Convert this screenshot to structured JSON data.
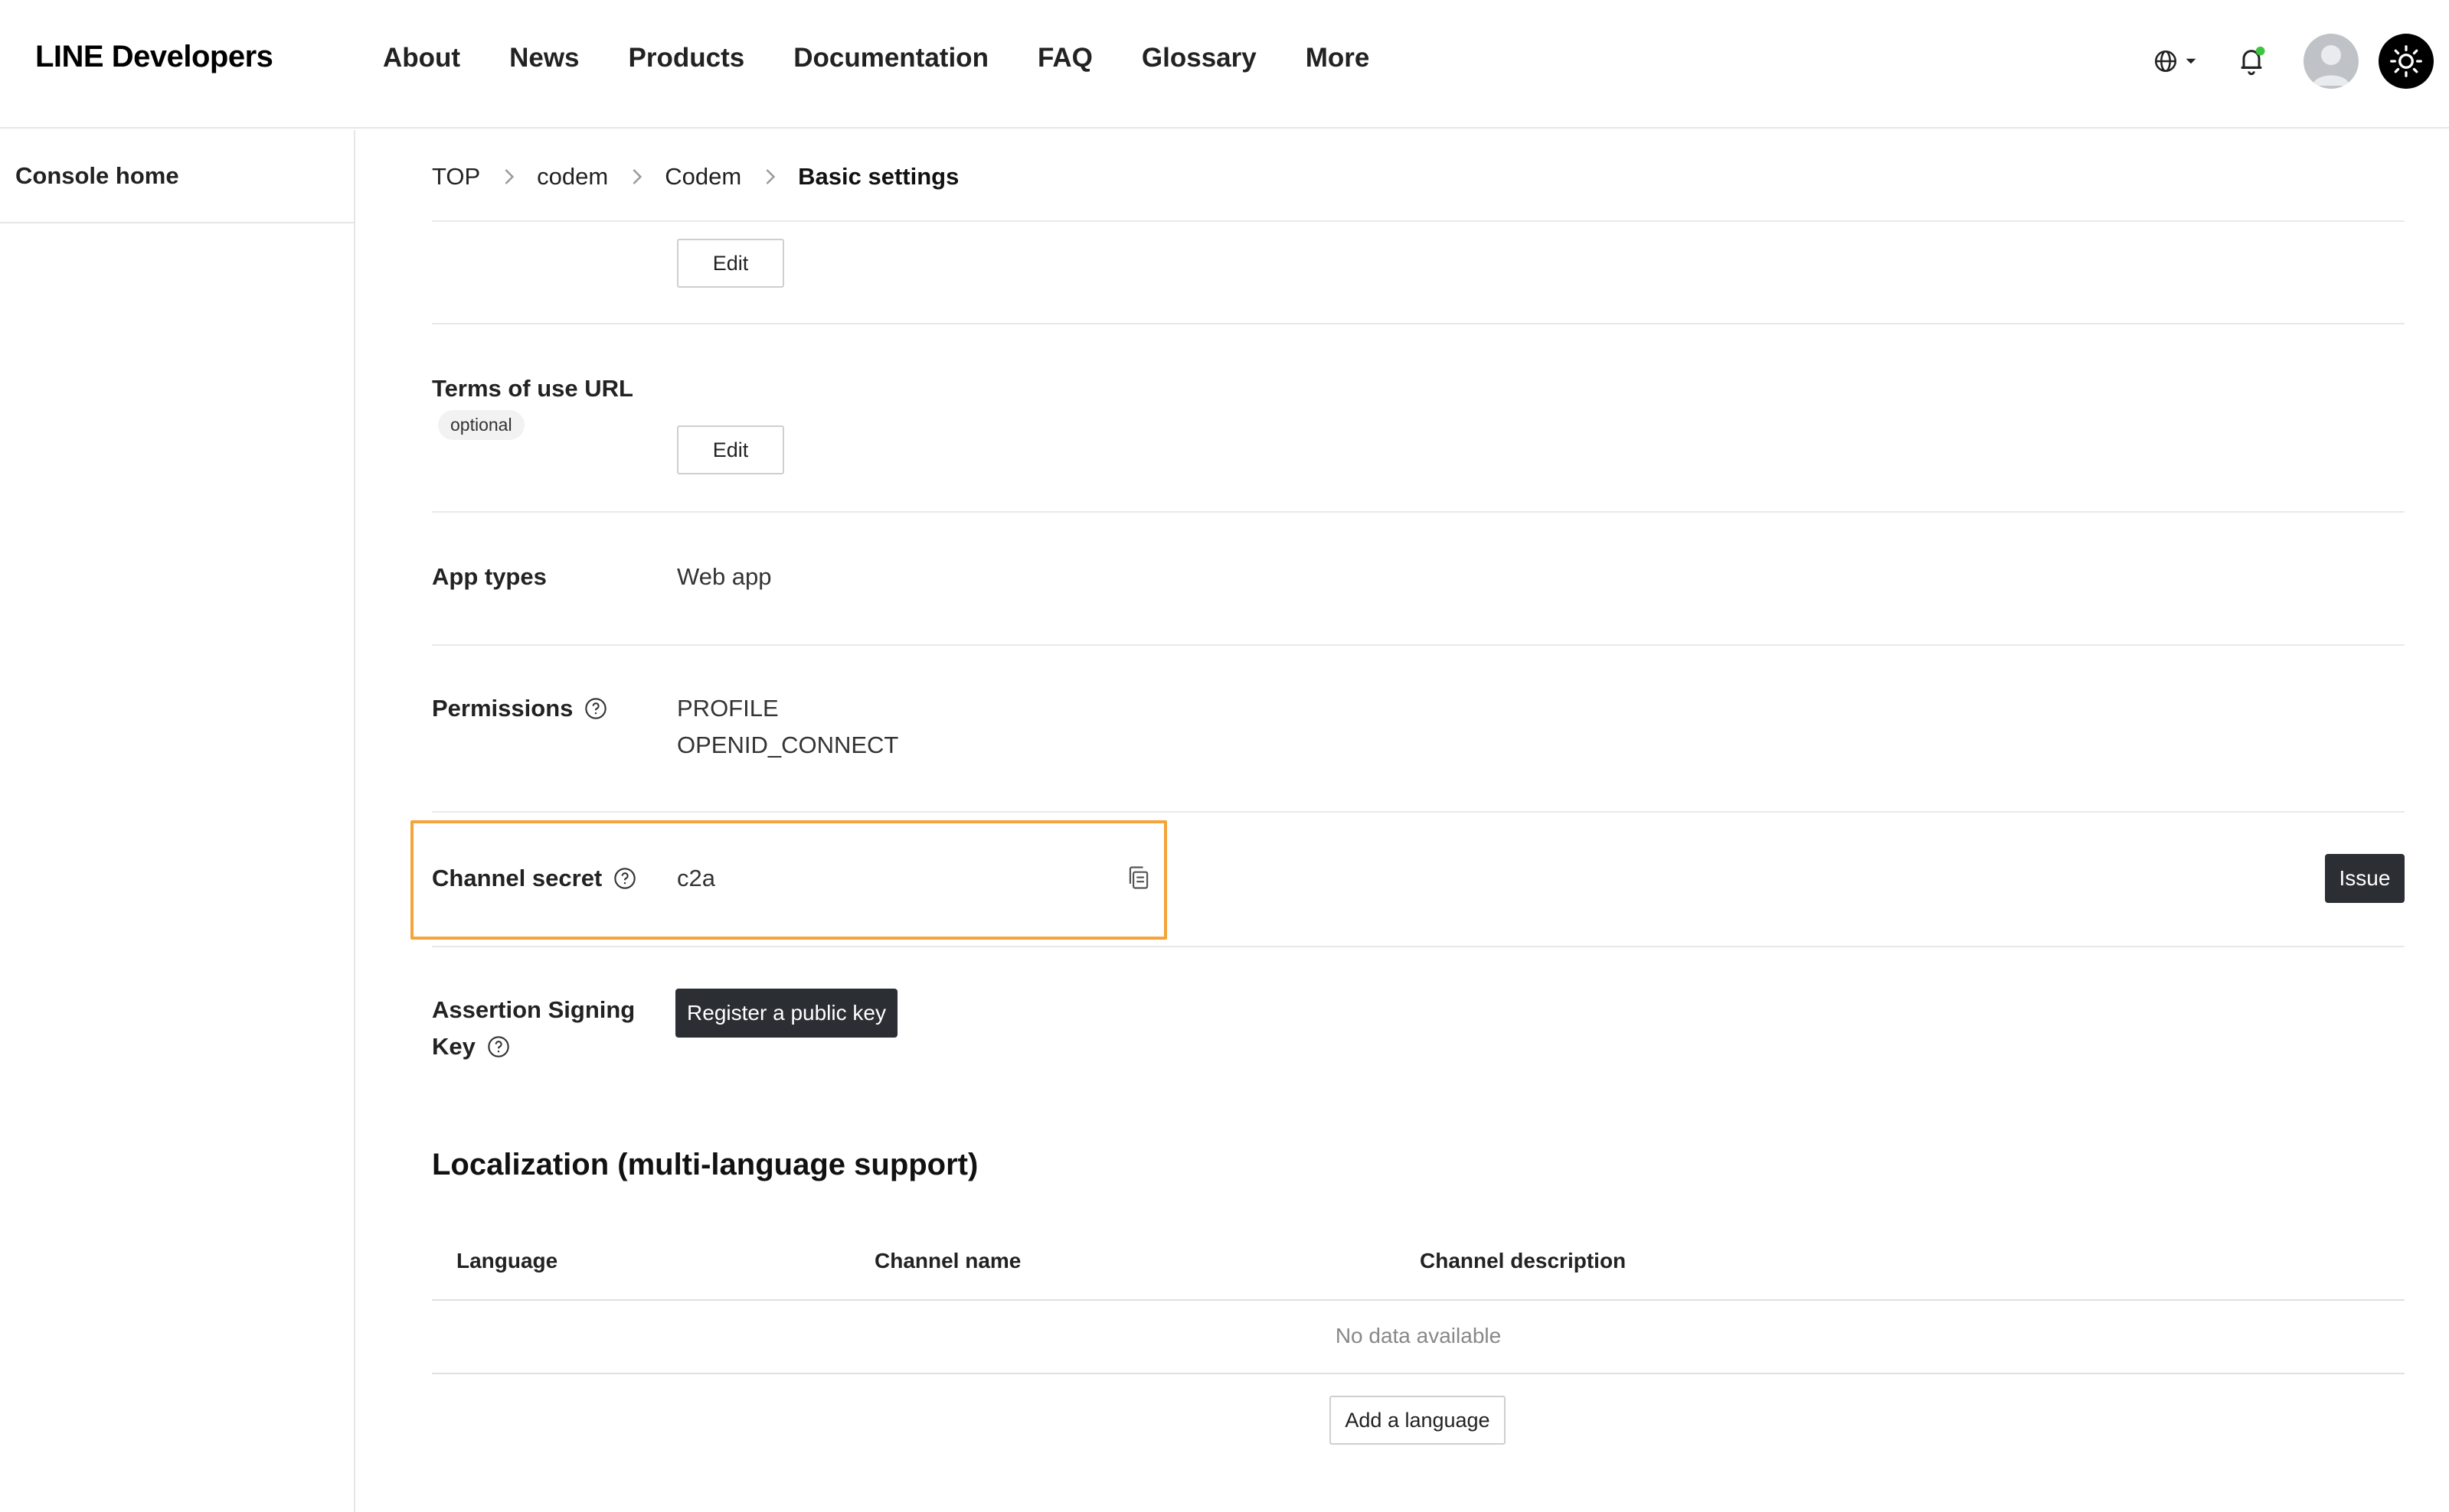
{
  "header": {
    "logo": "LINE Developers",
    "nav": [
      "About",
      "News",
      "Products",
      "Documentation",
      "FAQ",
      "Glossary",
      "More"
    ]
  },
  "sidebar": {
    "console_home": "Console home"
  },
  "breadcrumb": [
    "TOP",
    "codem",
    "Codem",
    "Basic settings"
  ],
  "privacy_row": {
    "edit_label": "Edit"
  },
  "terms_row": {
    "label": "Terms of use URL",
    "badge": "optional",
    "edit_label": "Edit"
  },
  "app_types": {
    "label": "App types",
    "value": "Web app"
  },
  "permissions": {
    "label": "Permissions",
    "values": [
      "PROFILE",
      "OPENID_CONNECT"
    ]
  },
  "channel_secret": {
    "label": "Channel secret",
    "value": "c2a",
    "issue_label": "Issue"
  },
  "assertion_key": {
    "label_line1": "Assertion Signing",
    "label_line2": "Key",
    "button_label": "Register a public key"
  },
  "localization": {
    "title": "Localization (multi-language support)",
    "columns": [
      "Language",
      "Channel name",
      "Channel description"
    ],
    "empty_text": "No data available",
    "add_label": "Add a language"
  },
  "colors": {
    "highlight": "#f5a33a",
    "dark_button": "#2b2e33",
    "notification_dot": "#3ec43e"
  },
  "icons": [
    "globe-icon",
    "caret-down-icon",
    "bell-icon",
    "avatar-icon",
    "sun-icon",
    "chevron-right-icon",
    "help-circle-icon",
    "copy-icon"
  ]
}
